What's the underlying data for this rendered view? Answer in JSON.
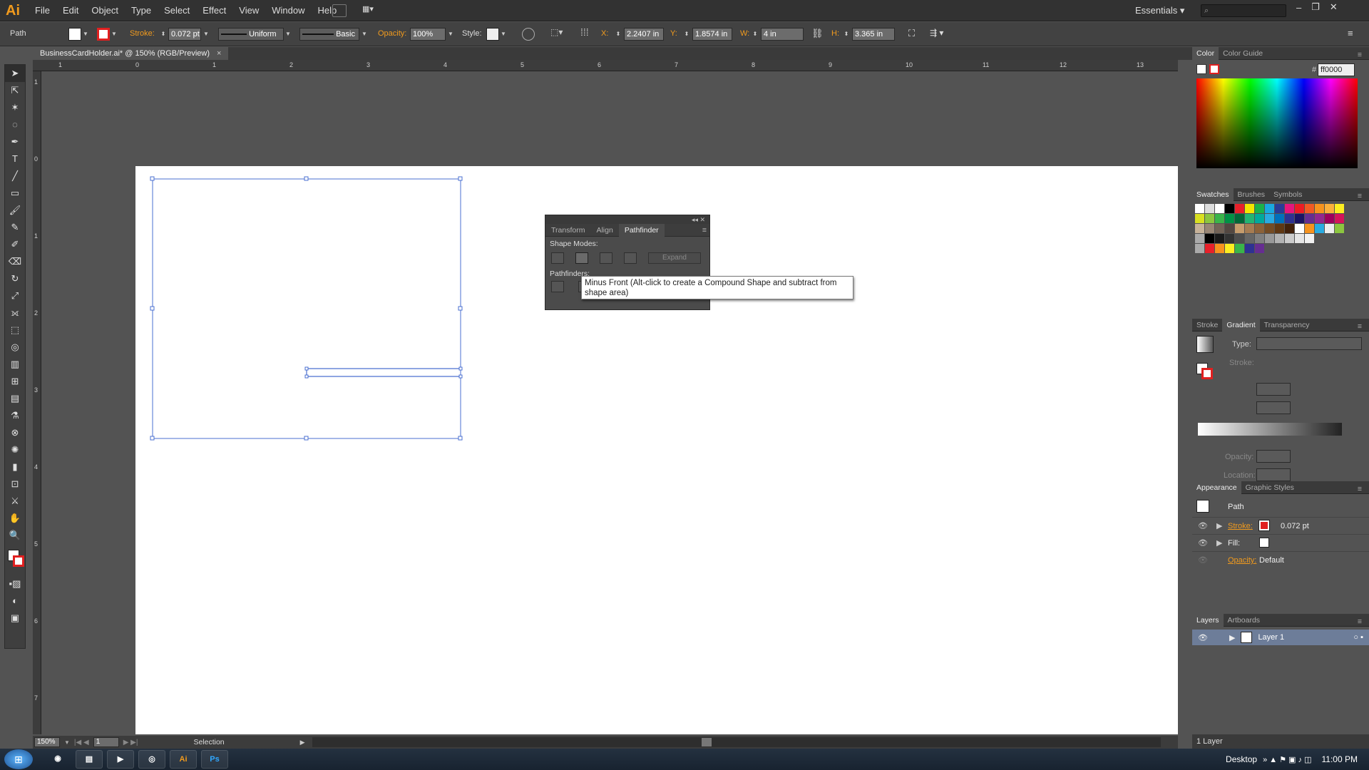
{
  "app": {
    "logo": "Ai"
  },
  "menu": [
    "File",
    "Edit",
    "Object",
    "Type",
    "Select",
    "Effect",
    "View",
    "Window",
    "Help"
  ],
  "workspace": {
    "label": "Essentials ▾",
    "search_placeholder": "⌕"
  },
  "control": {
    "selection_type": "Path",
    "stroke_label": "Stroke:",
    "stroke_value": "0.072 pt",
    "profile": "Uniform",
    "brush": "Basic",
    "opacity_label": "Opacity:",
    "opacity_value": "100%",
    "style_label": "Style:",
    "x_label": "X:",
    "x_value": "2.2407 in",
    "y_label": "Y:",
    "y_value": "1.8574 in",
    "w_label": "W:",
    "w_value": "4 in",
    "h_label": "H:",
    "h_value": "3.365 in"
  },
  "document_tab": {
    "title": "BusinessCardHolder.ai* @ 150% (RGB/Preview)",
    "close": "×"
  },
  "ruler_h": [
    "1",
    "0",
    "1",
    "2",
    "3",
    "4",
    "5",
    "6",
    "7",
    "8",
    "9",
    "10",
    "11",
    "12",
    "13"
  ],
  "ruler_v": [
    "1",
    "0",
    "1",
    "2",
    "3",
    "4",
    "5",
    "6",
    "7"
  ],
  "pathfinder": {
    "tabs": [
      "Transform",
      "Align",
      "Pathfinder"
    ],
    "shape_modes": "Shape Modes:",
    "expand": "Expand",
    "pathfinders": "Pathfinders:",
    "tooltip": "Minus Front (Alt-click to create a Compound Shape and subtract from shape area)"
  },
  "color_panel": {
    "tabs": [
      "Color",
      "Color Guide"
    ],
    "hex_label": "#",
    "hex": "ff0000"
  },
  "swatches_panel": {
    "tabs": [
      "Swatches",
      "Brushes",
      "Symbols"
    ]
  },
  "gradient_panel": {
    "tabs": [
      "Stroke",
      "Gradient",
      "Transparency"
    ],
    "type_label": "Type:",
    "stroke_label": "Stroke:",
    "opacity_label": "Opacity:",
    "location_label": "Location:"
  },
  "appearance_panel": {
    "tabs": [
      "Appearance",
      "Graphic Styles"
    ],
    "title": "Path",
    "rows": [
      {
        "label": "Stroke:",
        "value": "0.072 pt"
      },
      {
        "label": "Fill:",
        "value": ""
      },
      {
        "label": "Opacity:",
        "value": "Default"
      }
    ]
  },
  "layers_panel": {
    "tabs": [
      "Layers",
      "Artboards"
    ],
    "layer": "Layer 1",
    "count": "1 Layer"
  },
  "status": {
    "zoom": "150%",
    "artboard": "1",
    "tool": "Selection"
  },
  "taskbar": {
    "desktop": "Desktop",
    "time": "11:00 PM"
  },
  "colors": {
    "accent": "#f29b1d",
    "selection": "#4a6fd0",
    "stroke_red": "#ff0000"
  }
}
